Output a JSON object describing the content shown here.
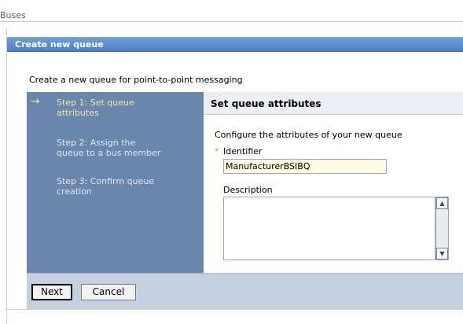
{
  "breadcrumb": "Buses",
  "header": {
    "title": "Create new queue"
  },
  "intro": "Create a new queue for point-to-point messaging",
  "wizard": {
    "steps": [
      {
        "label_line1": "Step 1: Set queue",
        "label_line2": "attributes",
        "active": true
      },
      {
        "label_line1": "Step 2: Assign the",
        "label_line2": "queue to a bus member",
        "active": false
      },
      {
        "label_line1": "Step 3: Confirm queue",
        "label_line2": "creation",
        "active": false
      }
    ],
    "arrow": "→"
  },
  "panel": {
    "title": "Set queue attributes",
    "description": "Configure the attributes of your new queue",
    "required_marker": "*",
    "identifier_label": "Identifier",
    "identifier_value": "ManufacturerBSIBQ",
    "description_label": "Description",
    "description_value": ""
  },
  "buttons": {
    "next": "Next",
    "cancel": "Cancel"
  },
  "icons": {
    "scroll_up": "scroll-up-arrow",
    "scroll_down": "scroll-down-arrow"
  },
  "colors": {
    "header_bar": "#4d7fc3",
    "wizard_bg": "#6a86ad",
    "footer_bg": "#c5d0de",
    "input_bg": "#fffce0"
  }
}
